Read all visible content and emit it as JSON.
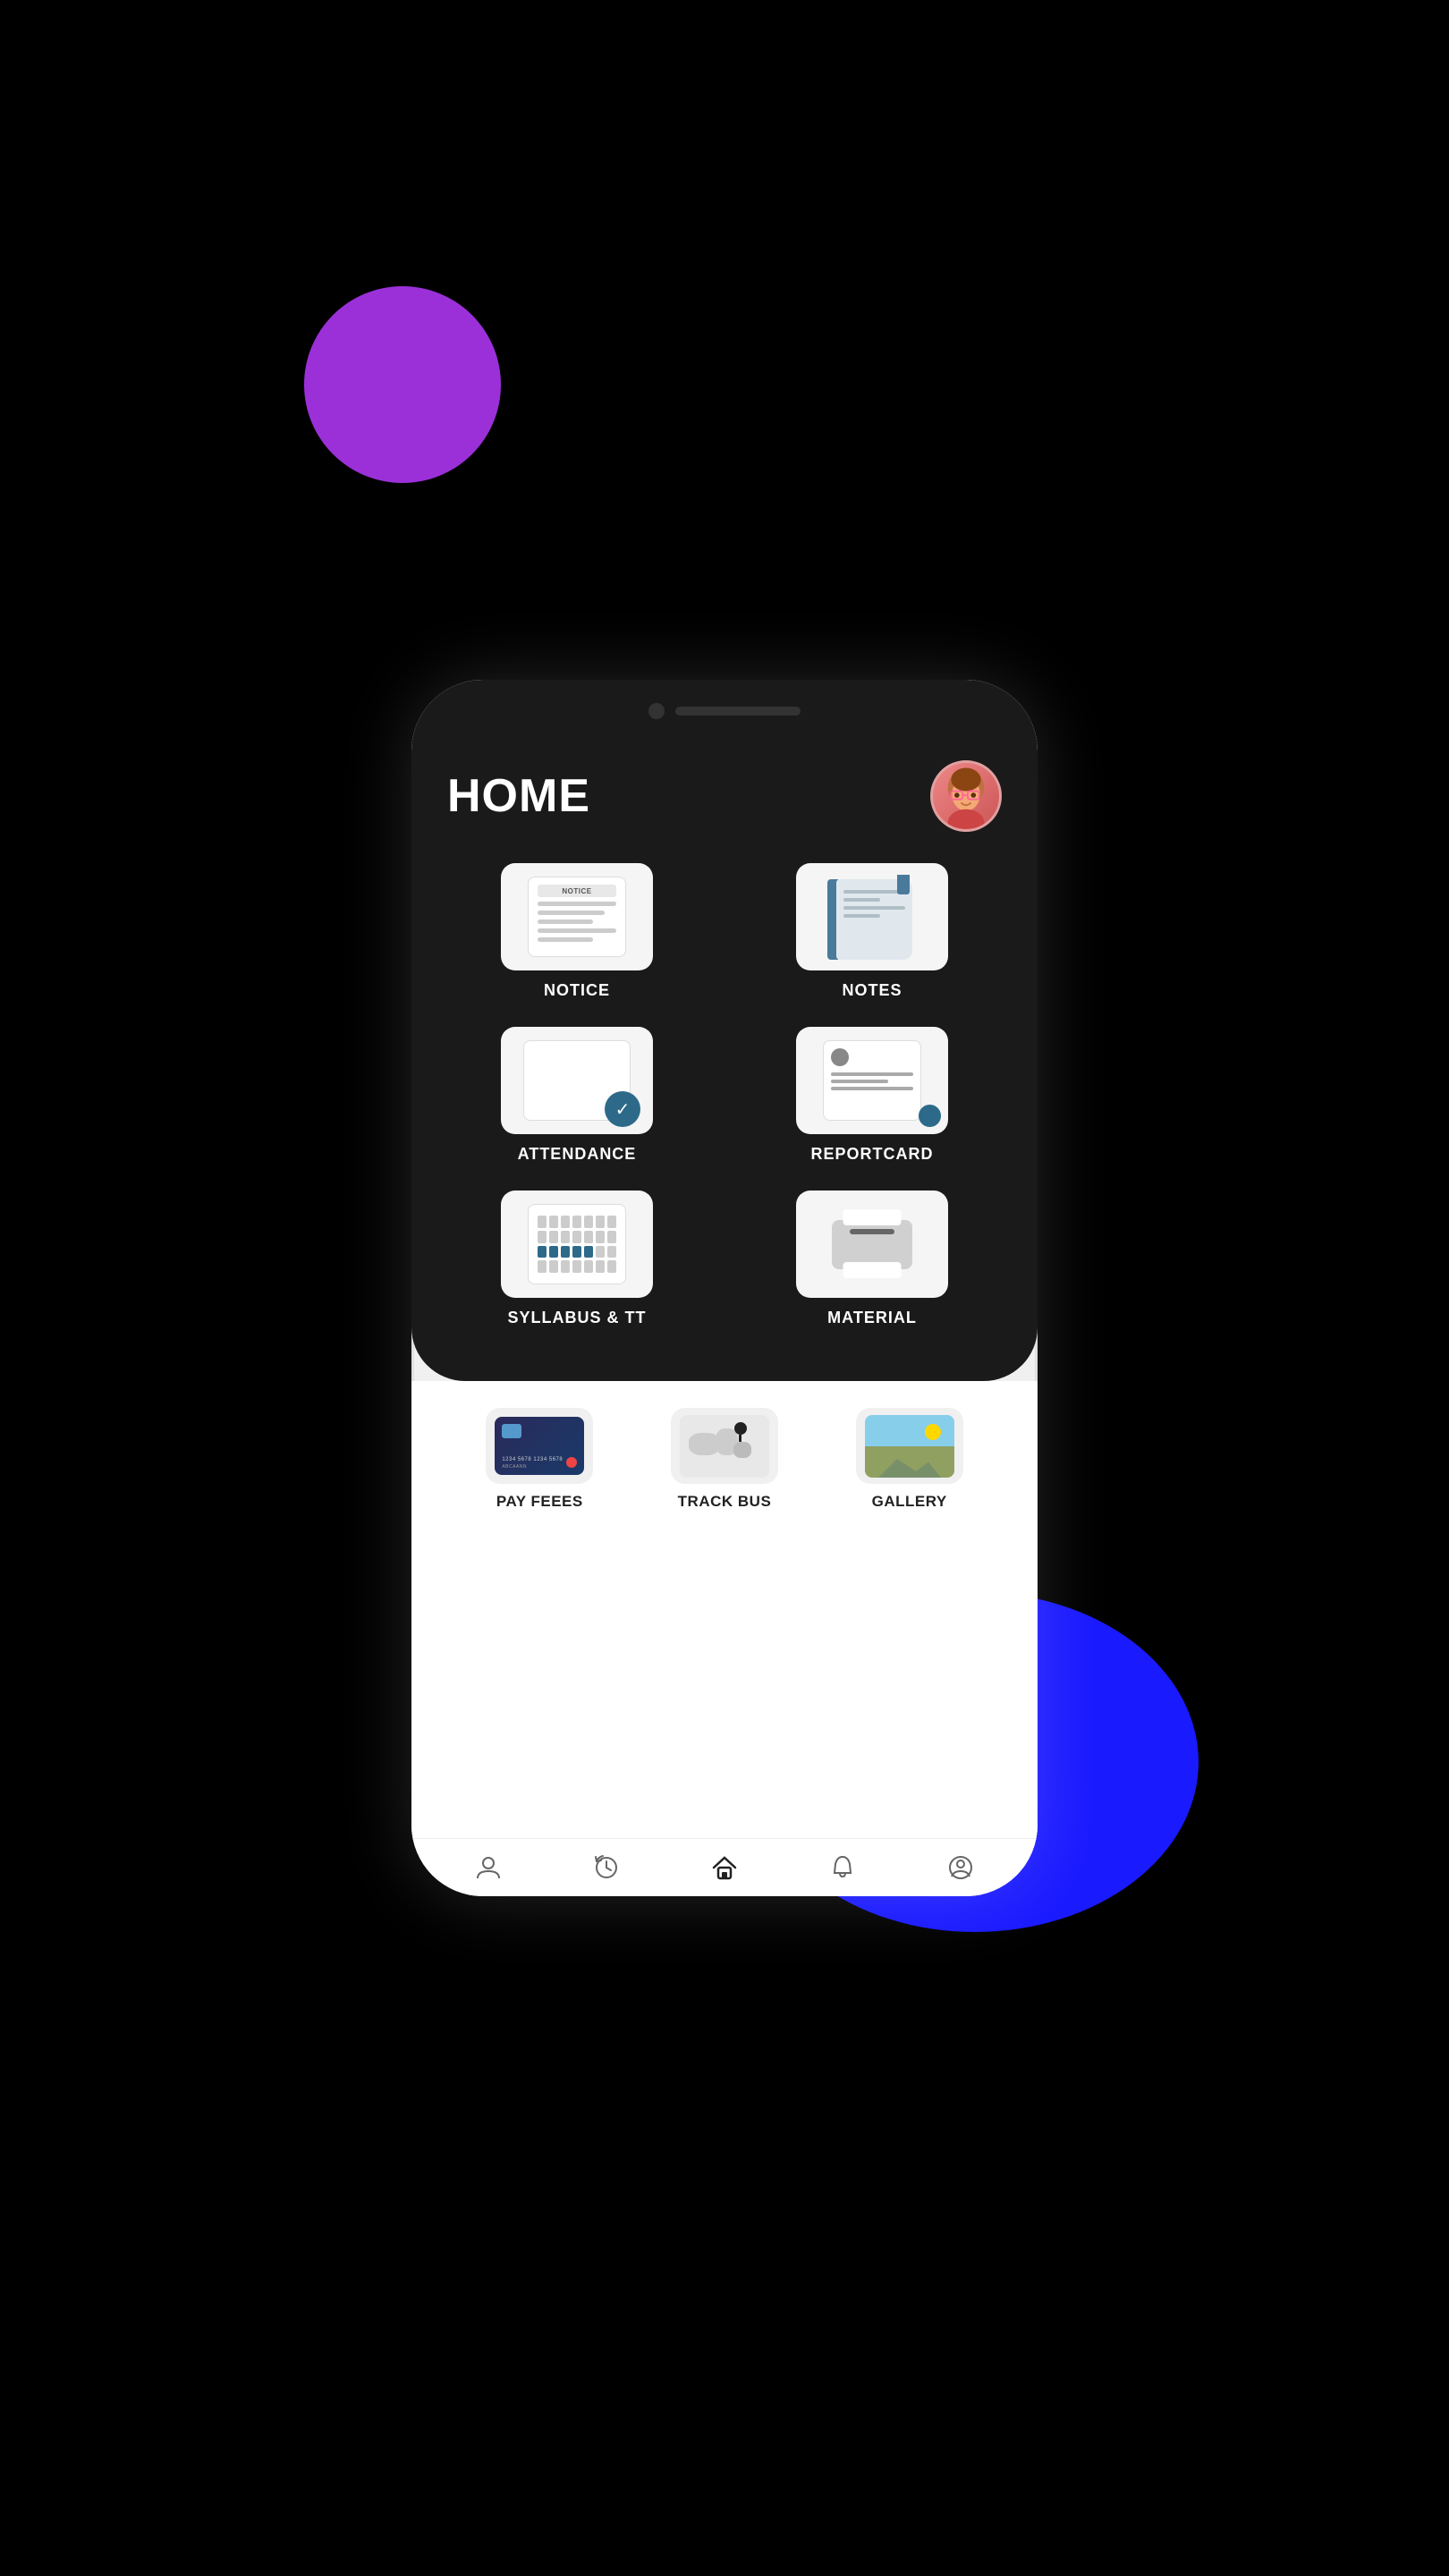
{
  "page": {
    "title": "HOME",
    "background_blobs": {
      "purple_color": "#9b30d9",
      "blue_color": "#1a1aff"
    }
  },
  "header": {
    "title": "HOME",
    "avatar_alt": "Student girl with glasses"
  },
  "grid_items": [
    {
      "id": "notice",
      "label": "NOTICE",
      "icon_type": "notice"
    },
    {
      "id": "notes",
      "label": "NOTES",
      "icon_type": "notes"
    },
    {
      "id": "attendance",
      "label": "ATTENDANCE",
      "icon_type": "attendance"
    },
    {
      "id": "reportcard",
      "label": "REPORTCARD",
      "icon_type": "reportcard"
    },
    {
      "id": "syllabus",
      "label": "SYLLABUS & TT",
      "icon_type": "syllabus"
    },
    {
      "id": "material",
      "label": "MATERIAL",
      "icon_type": "material"
    }
  ],
  "bottom_items": [
    {
      "id": "pay_fees",
      "label": "PAY FEEES",
      "icon_type": "card",
      "card_number": "1234 5678 1234 5678",
      "card_name": "ABCAANN"
    },
    {
      "id": "track_bus",
      "label": "TRACK BUS",
      "icon_type": "map"
    },
    {
      "id": "gallery",
      "label": "GALLERY",
      "icon_type": "gallery"
    }
  ],
  "bottom_nav": [
    {
      "id": "profile",
      "icon": "person",
      "label": "Profile",
      "active": false
    },
    {
      "id": "history",
      "icon": "history",
      "label": "History",
      "active": false
    },
    {
      "id": "home",
      "icon": "home",
      "label": "Home",
      "active": true
    },
    {
      "id": "bell",
      "icon": "notifications",
      "label": "Notifications",
      "active": false
    },
    {
      "id": "user",
      "icon": "account",
      "label": "Account",
      "active": false
    }
  ]
}
